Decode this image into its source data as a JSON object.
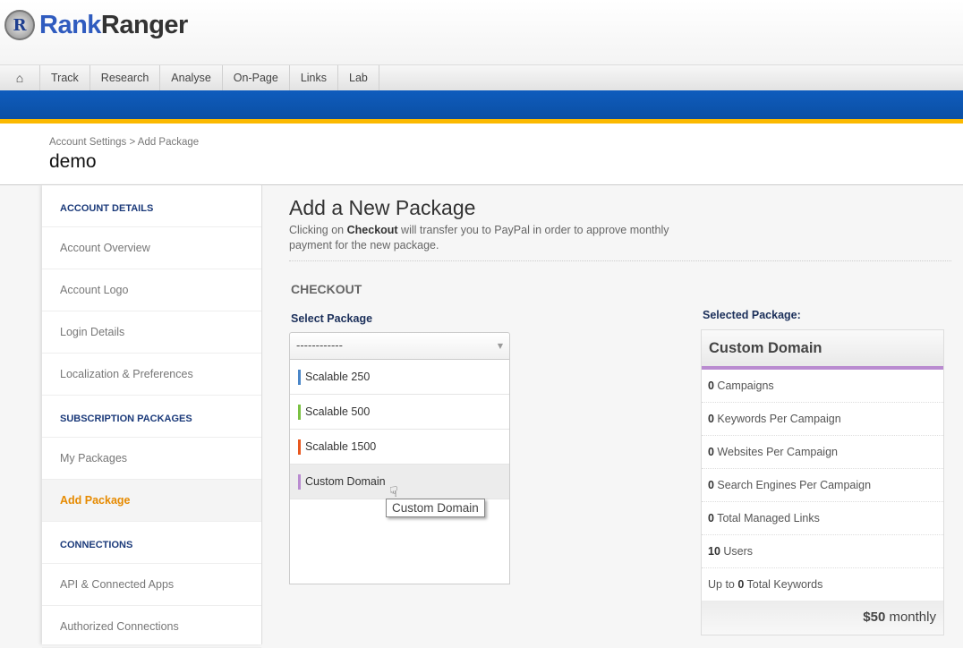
{
  "logo": {
    "letter": "R",
    "part1": "Rank",
    "part2": "Ranger"
  },
  "nav": {
    "items": [
      "Track",
      "Research",
      "Analyse",
      "On-Page",
      "Links",
      "Lab"
    ]
  },
  "breadcrumb": "Account Settings > Add Package",
  "account_name": "demo",
  "sidebar": {
    "sections": [
      {
        "header": "ACCOUNT DETAILS",
        "items": [
          "Account Overview",
          "Account Logo",
          "Login Details",
          "Localization & Preferences"
        ]
      },
      {
        "header": "SUBSCRIPTION PACKAGES",
        "items": [
          "My Packages",
          "Add Package"
        ]
      },
      {
        "header": "CONNECTIONS",
        "items": [
          "API & Connected Apps",
          "Authorized Connections"
        ]
      }
    ],
    "active": "Add Package"
  },
  "main": {
    "title": "Add a New Package",
    "desc_pre": "Clicking on ",
    "desc_bold": "Checkout",
    "desc_post": " will transfer you to PayPal in order to approve monthly payment for the new package.",
    "checkout": "CHECKOUT",
    "select_label": "Select Package",
    "select_value": "------------",
    "options": [
      {
        "label": "Scalable 250",
        "color": "#4a86c8"
      },
      {
        "label": "Scalable 500",
        "color": "#7ac142"
      },
      {
        "label": "Scalable 1500",
        "color": "#e8571e"
      },
      {
        "label": "Custom Domain",
        "color": "#b98bd0"
      }
    ],
    "tooltip": "Custom Domain"
  },
  "selected": {
    "label": "Selected Package:",
    "name": "Custom Domain",
    "color": "#b98bd0",
    "rows": [
      {
        "pre": "",
        "num": "0",
        "text": " Campaigns"
      },
      {
        "pre": "",
        "num": "0",
        "text": " Keywords Per Campaign"
      },
      {
        "pre": "",
        "num": "0",
        "text": " Websites Per Campaign"
      },
      {
        "pre": "",
        "num": "0",
        "text": " Search Engines Per Campaign"
      },
      {
        "pre": "",
        "num": "0",
        "text": " Total Managed Links"
      },
      {
        "pre": "",
        "num": "10",
        "text": " Users"
      },
      {
        "pre": "Up to ",
        "num": "0",
        "text": " Total Keywords"
      }
    ],
    "price": "$50",
    "period": " monthly"
  }
}
